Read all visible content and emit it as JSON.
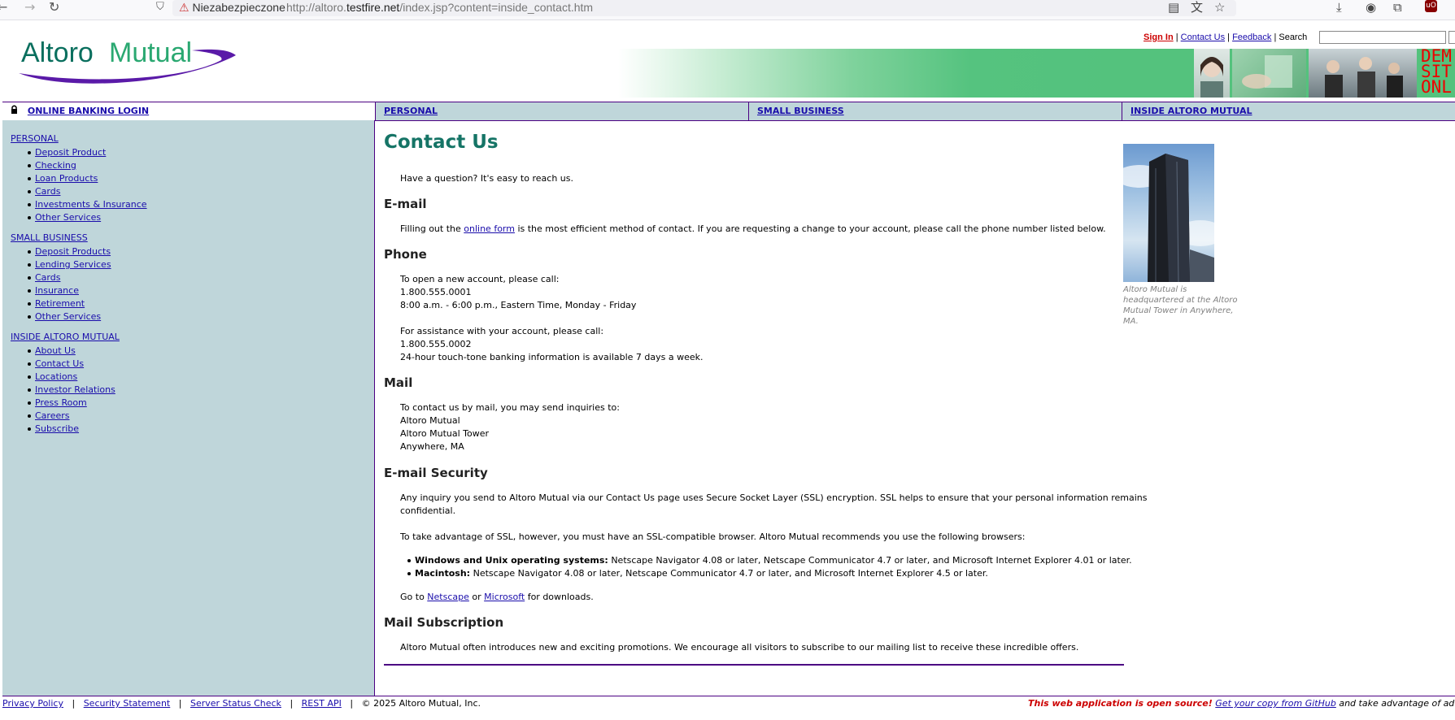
{
  "browser": {
    "security_label": "Niezabezpieczone",
    "url_prefix": "http://altoro.",
    "url_domain": "testfire.net",
    "url_path": "/index.jsp?content=inside_contact.htm"
  },
  "header": {
    "logo_part1": "Altoro",
    "logo_part2": "Mutual",
    "logo_color_1": "#0a6f5e",
    "logo_color_2": "#2aa871",
    "swoosh_color": "#5a1aa8",
    "sign_in": "Sign In",
    "contact_us": "Contact Us",
    "feedback": "Feedback",
    "search_label": "Search",
    "separator": "|",
    "demo_lines": [
      "DEM",
      "SIT",
      "ONL"
    ]
  },
  "nav": {
    "login": "ONLINE BANKING LOGIN",
    "personal": "PERSONAL",
    "small_business": "SMALL BUSINESS",
    "inside": "INSIDE ALTORO MUTUAL"
  },
  "sidebar": {
    "personal": {
      "title": "PERSONAL",
      "items": [
        "Deposit Product",
        "Checking",
        "Loan Products",
        "Cards",
        "Investments & Insurance",
        "Other Services"
      ]
    },
    "small_business": {
      "title": "SMALL BUSINESS",
      "items": [
        "Deposit Products",
        "Lending Services",
        "Cards",
        "Insurance",
        "Retirement",
        "Other Services"
      ]
    },
    "inside": {
      "title": "INSIDE ALTORO MUTUAL",
      "items": [
        "About Us",
        "Contact Us",
        "Locations",
        "Investor Relations",
        "Press Room",
        "Careers",
        "Subscribe"
      ]
    }
  },
  "content": {
    "title": "Contact Us",
    "intro": "Have a question? It's easy to reach us.",
    "email_heading": "E-mail",
    "email_pre": "Filling out the ",
    "email_link": "online form",
    "email_post": " is the most efficient method of contact. If you are requesting a change to your account, please call the phone number listed below.",
    "phone_heading": "Phone",
    "phone_open": "To open a new account, please call:",
    "phone_open_number": "1.800.555.0001",
    "phone_open_hours": "8:00 a.m. - 6:00 p.m., Eastern Time, Monday - Friday",
    "phone_assist": "For assistance with your account, please call:",
    "phone_assist_number": "1.800.555.0002",
    "phone_assist_hours": "24-hour touch-tone banking information is available 7 days a week.",
    "mail_heading": "Mail",
    "mail_intro": "To contact us by mail, you may send inquiries to:",
    "mail_line1": "Altoro Mutual",
    "mail_line2": "Altoro Mutual Tower",
    "mail_line3": "Anywhere, MA",
    "security_heading": "E-mail Security",
    "security_p1_line1": "Any inquiry you send to Altoro Mutual via our Contact Us page uses Secure Socket Layer (SSL) encryption. SSL helps to ensure that your personal information remains",
    "security_p1_line2": "confidential.",
    "security_p2": "To take advantage of SSL, however, you must have an SSL-compatible browser. Altoro Mutual recommends you use the following browsers:",
    "browser1_label": "Windows and Unix operating systems:",
    "browser1_text": " Netscape Navigator 4.08 or later, Netscape Communicator 4.7 or later, and Microsoft Internet Explorer 4.01 or later.",
    "browser2_label": "Macintosh:",
    "browser2_text": " Netscape Navigator 4.08 or later, Netscape Communicator 4.7 or later, and Microsoft Internet Explorer 4.5 or later.",
    "goto_pre": "Go to ",
    "goto_netscape": "Netscape",
    "goto_or": " or ",
    "goto_microsoft": "Microsoft",
    "goto_post": " for downloads.",
    "subscription_heading": "Mail Subscription",
    "subscription_text": "Altoro Mutual often introduces new and exciting promotions. We encourage all visitors to subscribe to our mailing list to receive these incredible offers.",
    "image_caption": "Altoro Mutual is headquartered at the Altoro Mutual Tower in Anywhere, MA."
  },
  "footer": {
    "privacy": "Privacy Policy",
    "security": "Security Statement",
    "status": "Server Status Check",
    "rest": "REST API",
    "separator": "|",
    "copyright": "© 2025 Altoro Mutual, Inc.",
    "open_source": "This web application is open source!",
    "github_link": "Get your copy from GitHub",
    "tail": " and take advantage of advanced fe"
  }
}
